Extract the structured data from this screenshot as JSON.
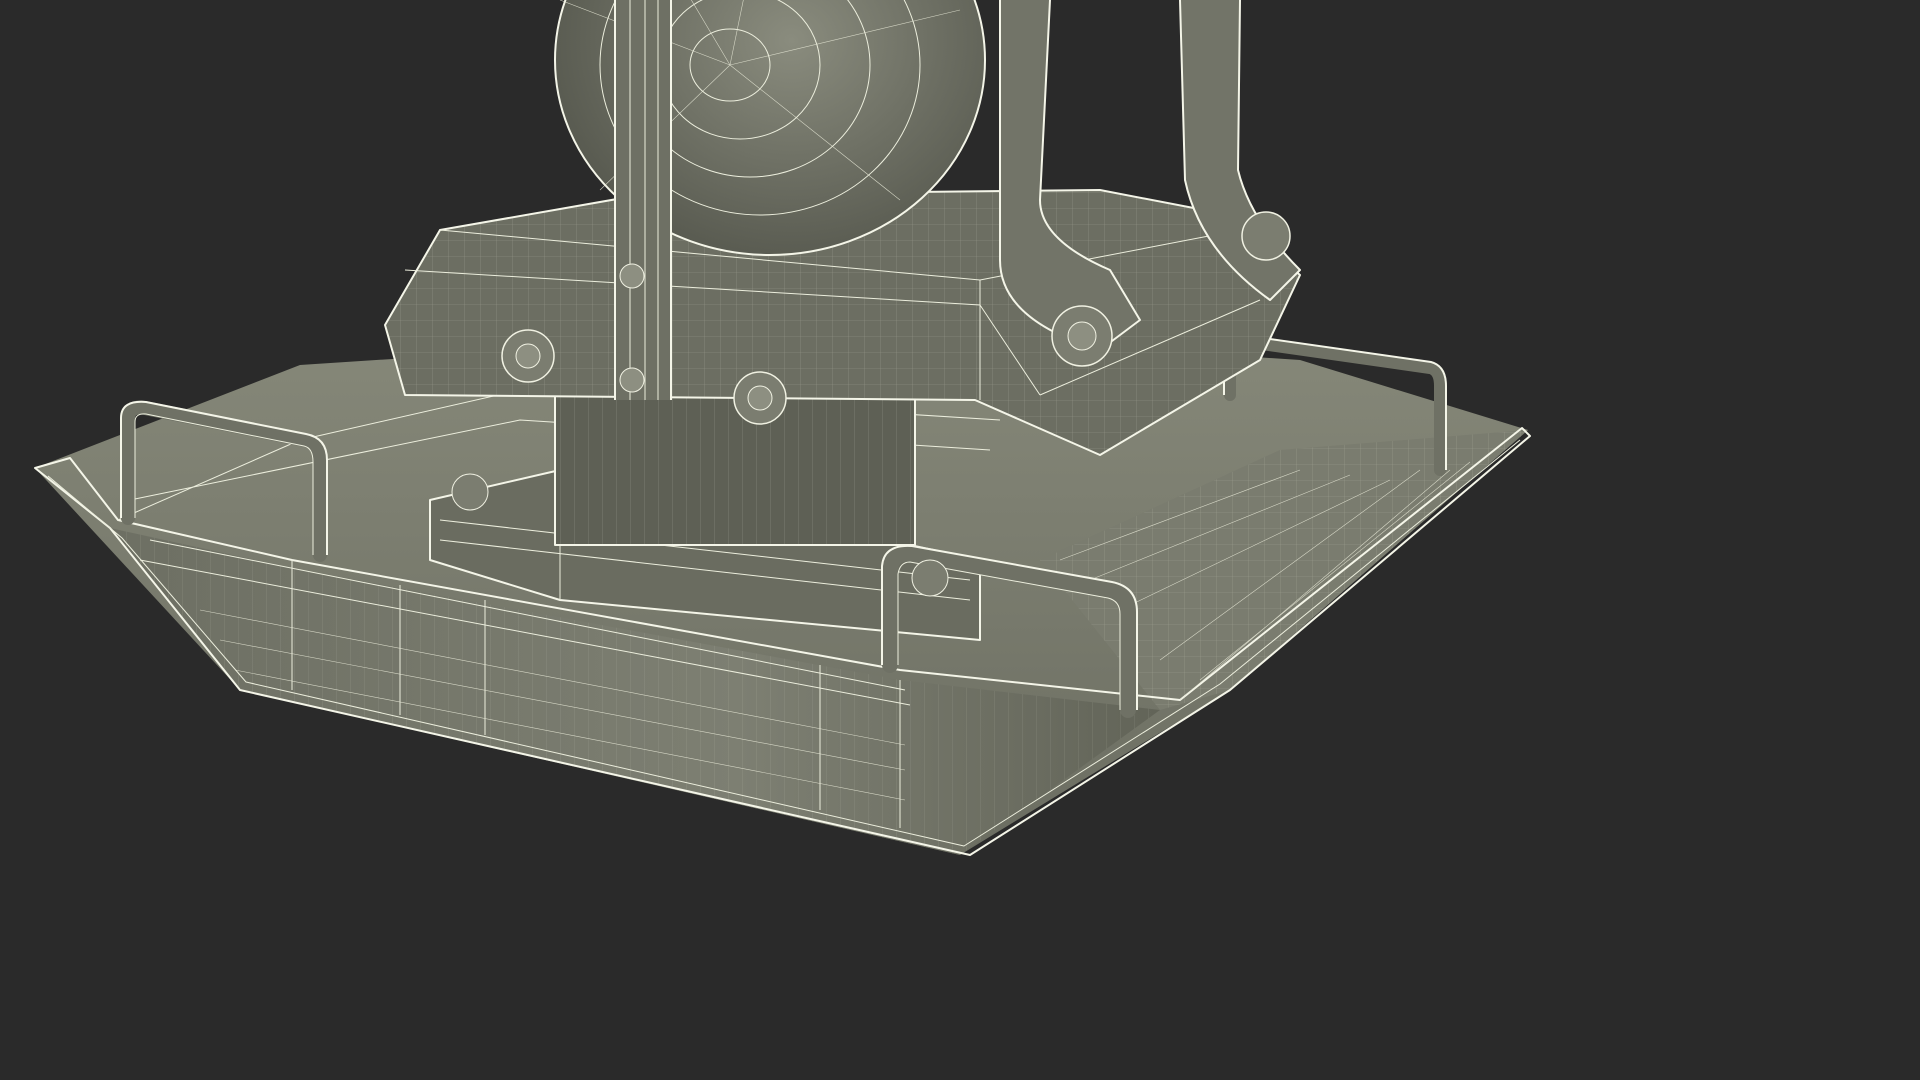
{
  "scene": {
    "subject": "plate-compactor-wireframe-render",
    "colors": {
      "background": "#2a2a2a",
      "surface_dark": "#5f6157",
      "surface_mid": "#74766a",
      "surface_light": "#8c8e81",
      "wire": "#eceedd"
    }
  }
}
